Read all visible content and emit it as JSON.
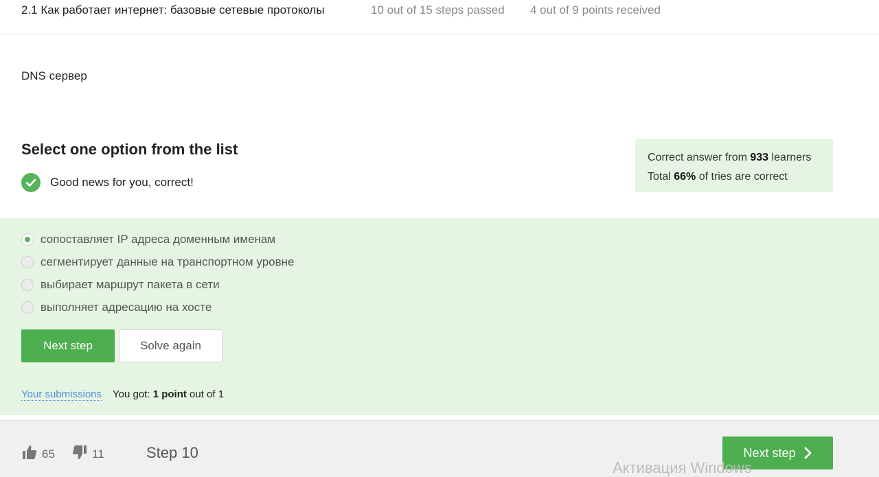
{
  "header": {
    "lesson_title": "2.1 Как работает интернет: базовые сетевые протоколы",
    "steps_passed": "10 out of 15 steps passed",
    "points_received": "4 out of 9 points  received"
  },
  "question": {
    "text": "DNS сервер"
  },
  "quiz": {
    "heading": "Select one option from the list",
    "feedback": "Good news for you, correct!"
  },
  "stats": {
    "line1_prefix": "Correct answer from ",
    "learners_count": "933",
    "line1_suffix": " learners",
    "line2_prefix": "Total ",
    "percent_correct": "66%",
    "line2_suffix": " of tries are correct"
  },
  "options": [
    {
      "label": "сопоставляет IP адреса доменным именам",
      "selected": true
    },
    {
      "label": "сегментирует данные на транспортном уровне",
      "selected": false
    },
    {
      "label": "выбирает маршрут пакета в сети",
      "selected": false
    },
    {
      "label": "выполняет адресацию на хосте",
      "selected": false
    }
  ],
  "actions": {
    "next_step": "Next step",
    "solve_again": "Solve again"
  },
  "submissions": {
    "link": "Your submissions",
    "got_prefix": "You got: ",
    "points": "1 point",
    "got_suffix": " out of 1"
  },
  "footer": {
    "likes": "65",
    "dislikes": "11",
    "step": "Step 10",
    "next_step": "Next step"
  },
  "watermark": "Активация Windows",
  "colors": {
    "accent_green": "#4cae4f",
    "light_green_bg": "#e6f5e3",
    "link_blue": "#4a8fe0"
  }
}
